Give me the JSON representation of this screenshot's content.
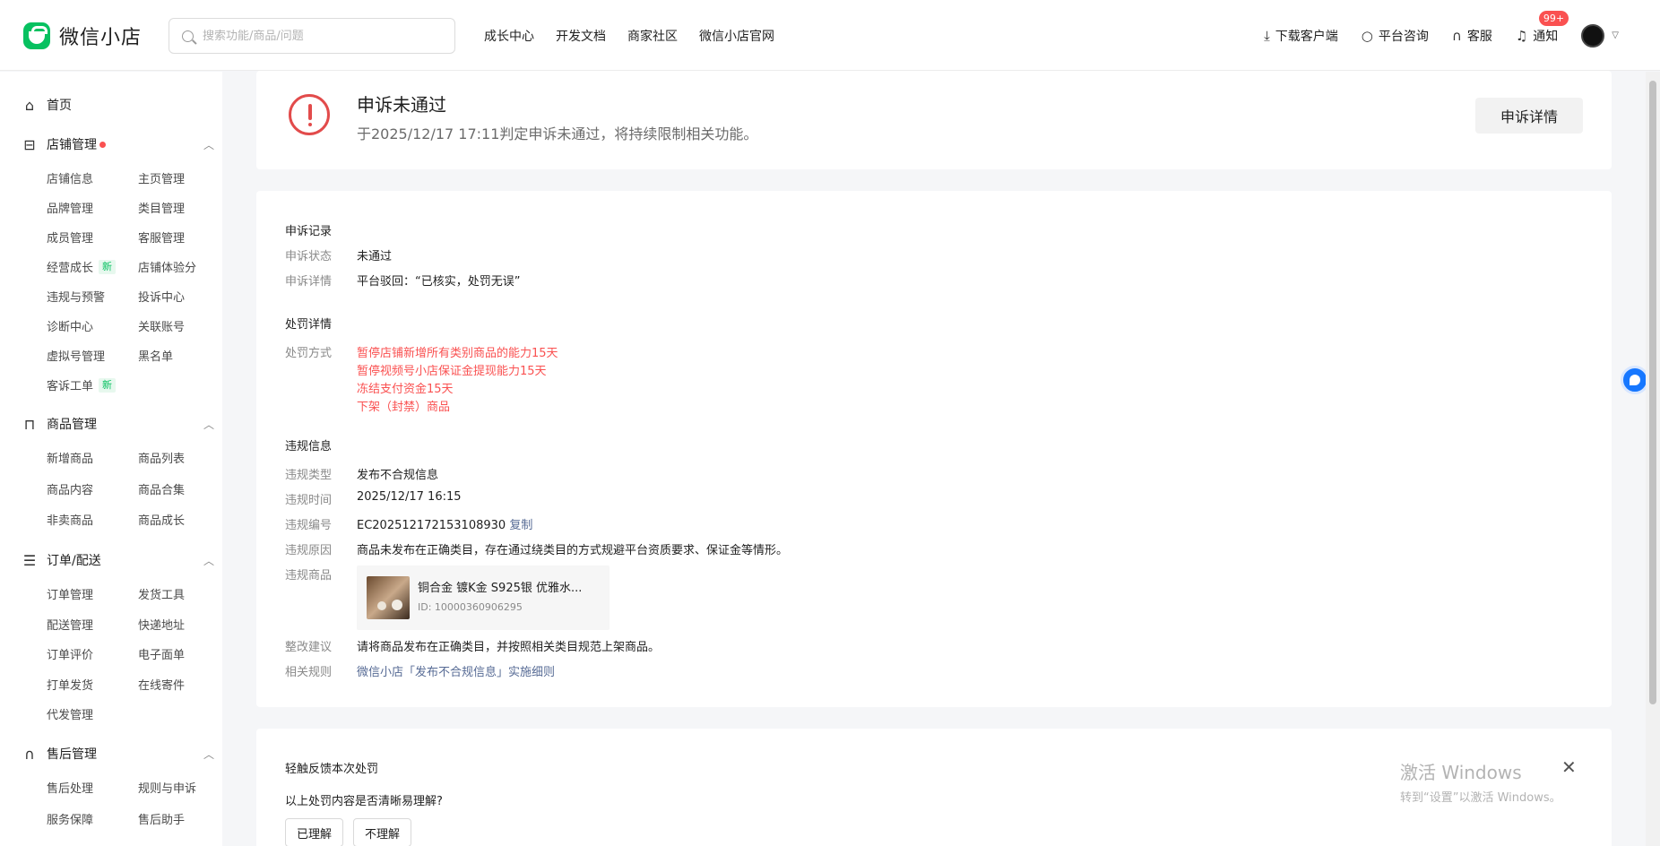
{
  "header": {
    "logo_text": "微信小店",
    "search_placeholder": "搜索功能/商品/问题",
    "nav": [
      "成长中心",
      "开发文档",
      "商家社区",
      "微信小店官网"
    ],
    "right": {
      "download": "下载客户端",
      "consult": "平台咨询",
      "service": "客服",
      "notify": "通知",
      "notify_badge": "99+"
    }
  },
  "sidebar": {
    "home": "首页",
    "shop": {
      "title": "店铺管理",
      "items": [
        "店铺信息",
        "主页管理",
        "品牌管理",
        "类目管理",
        "成员管理",
        "客服管理",
        "经营成长",
        "店铺体验分",
        "违规与预警",
        "投诉中心",
        "诊断中心",
        "关联账号",
        "虚拟号管理",
        "黑名单",
        "客诉工单"
      ]
    },
    "goods": {
      "title": "商品管理",
      "items": [
        "新增商品",
        "商品列表",
        "商品内容",
        "商品合集",
        "非卖商品",
        "商品成长"
      ]
    },
    "orders": {
      "title": "订单/配送",
      "items": [
        "订单管理",
        "发货工具",
        "配送管理",
        "快递地址",
        "订单评价",
        "电子面单",
        "打单发货",
        "在线寄件",
        "代发管理"
      ]
    },
    "aftersale": {
      "title": "售后管理",
      "items": [
        "售后处理",
        "规则与申诉",
        "服务保障",
        "售后助手"
      ]
    },
    "new_tag": "新"
  },
  "alert": {
    "title": "申诉未通过",
    "desc": "于2025/12/17 17:11判定申诉未通过，将持续限制相关功能。",
    "button": "申诉详情"
  },
  "record": {
    "title": "申诉记录",
    "status_label": "申诉状态",
    "status": "未通过",
    "detail_label": "申诉详情",
    "detail": "平台驳回：“已核实，处罚无误”"
  },
  "penalty": {
    "title": "处罚详情",
    "method_label": "处罚方式",
    "methods": [
      "暂停店铺新增所有类别商品的能力15天",
      "暂停视频号小店保证金提现能力15天",
      "冻结支付资金15天",
      "下架（封禁）商品"
    ]
  },
  "violation": {
    "title": "违规信息",
    "type_label": "违规类型",
    "type": "发布不合规信息",
    "time_label": "违规时间",
    "time": "2025/12/17 16:15",
    "no_label": "违规编号",
    "no": "EC202512172153108930",
    "copy": "复制",
    "reason_label": "违规原因",
    "reason": "商品未发布在正确类目，存在通过绕类目的方式规避平台资质要求、保证金等情形。",
    "goods_label": "违规商品",
    "product_name": "铜合金 镀K金 S925银 优雅水...",
    "product_id": "ID: 10000360906295",
    "advice_label": "整改建议",
    "advice": "请将商品发布在正确类目，并按照相关类目规范上架商品。",
    "rule_label": "相关规则",
    "rule": "微信小店「发布不合规信息」实施细则"
  },
  "feedback": {
    "title": "轻触反馈本次处罚",
    "question": "以上处罚内容是否清晰易理解?",
    "yes": "已理解",
    "no": "不理解"
  },
  "watermark": {
    "line1": "激活 Windows",
    "line2": "转到“设置”以激活 Windows。"
  }
}
